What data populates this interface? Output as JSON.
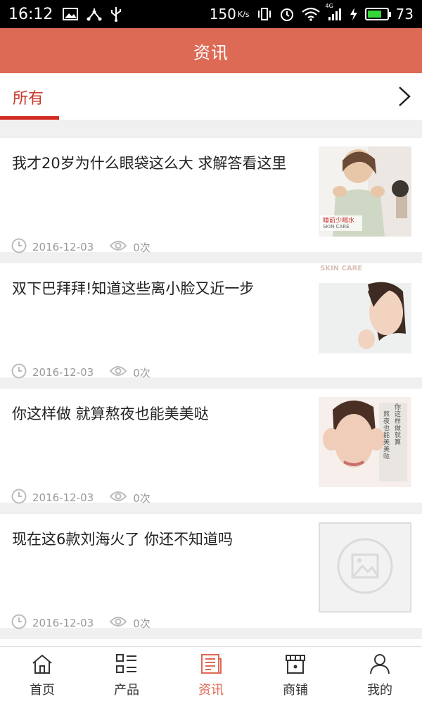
{
  "status_bar": {
    "time": "16:12",
    "network_speed": "150",
    "network_unit": "K/s",
    "signal_label": "4G",
    "battery": "73",
    "battery_level": 0.73
  },
  "header": {
    "title": "资讯"
  },
  "categories": {
    "active": "所有"
  },
  "articles": [
    {
      "title": "我才20岁为什么眼袋这么大 求解答看这里",
      "date": "2016-12-03",
      "views": "0次",
      "thumb_caption": "睡前少喝水",
      "thumb_caption2": "SKIN CARE"
    },
    {
      "title": "双下巴拜拜!知道这些离小脸又近一步",
      "date": "2016-12-03",
      "views": "0次",
      "thumb_caption": "SKIN CARE"
    },
    {
      "title": "你这样做 就算熬夜也能美美哒",
      "date": "2016-12-03",
      "views": "0次",
      "thumb_caption": "你这样做 就算",
      "thumb_caption2": "熬夜也能美美哒"
    },
    {
      "title": "现在这6款刘海火了 你还不知道吗",
      "date": "2016-12-03",
      "views": "0次"
    }
  ],
  "nav": [
    {
      "label": "首页",
      "icon": "home-icon"
    },
    {
      "label": "产品",
      "icon": "product-list-icon"
    },
    {
      "label": "资讯",
      "icon": "news-icon",
      "active": true
    },
    {
      "label": "商铺",
      "icon": "shop-icon"
    },
    {
      "label": "我的",
      "icon": "user-icon"
    }
  ],
  "colors": {
    "header": "#dd6a55",
    "accent": "#d22b22",
    "active_nav": "#dd6a55"
  }
}
